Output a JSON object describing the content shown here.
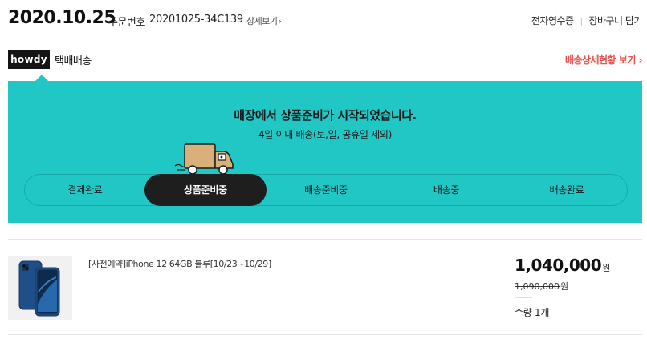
{
  "header": {
    "date": "2020.10.25",
    "order_label": "주문번호",
    "order_number": "20201025-34C139",
    "detail_link": "상세보기",
    "receipt_link": "전자영수증",
    "cart_link": "장바구니 담기"
  },
  "courier": {
    "logo_text": "howdy",
    "label": "택배배송",
    "track_link": "배송상세현황 보기"
  },
  "status": {
    "title": "매장에서 상품준비가 시작되었습니다.",
    "subtitle": "4일 이내 배송(토,일, 공휴일 제외)",
    "steps": [
      "결제완료",
      "상품준비중",
      "배송준비중",
      "배송중",
      "배송완료"
    ],
    "active_step": "상품준비중",
    "colors": {
      "panel": "#21c7c4",
      "active": "#1e1e1e",
      "link": "#e8534e"
    }
  },
  "product": {
    "name": "[사전예약]iPhone 12 64GB 블루[10/23~10/29]",
    "price": "1,040,000",
    "original_price": "1,090,000",
    "currency": "원",
    "quantity": "수량 1개",
    "image_icon": "iphone-blue-image"
  }
}
